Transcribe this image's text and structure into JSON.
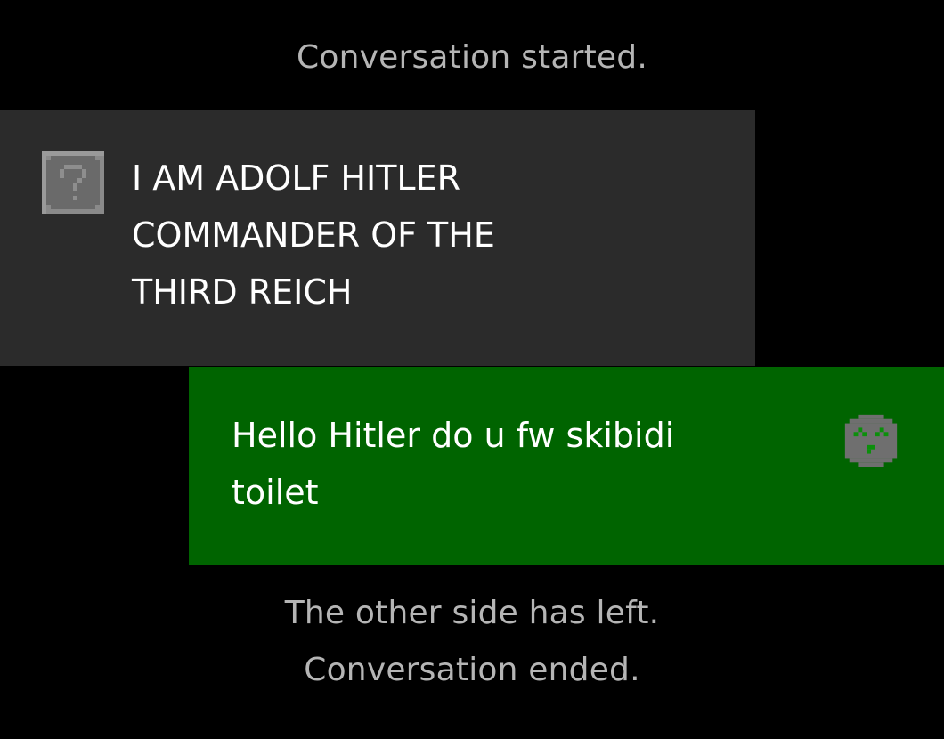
{
  "chat": {
    "start_notice": "Conversation started.",
    "messages": [
      {
        "sender": "stranger",
        "text": "I AM ADOLF HITLER\nCOMMANDER OF THE\nTHIRD REICH",
        "avatar_icon": "question-block-icon",
        "bubble_color": "#2b2b2b"
      },
      {
        "sender": "you",
        "text": "Hello Hitler do u fw skibidi\ntoilet",
        "avatar_icon": "pixel-smiley-face-icon",
        "bubble_color": "#006400"
      }
    ],
    "left_notice": "The other side has left.",
    "end_notice": "Conversation ended."
  },
  "colors": {
    "background": "#000000",
    "notice_text": "#b5b5b5",
    "message_text": "#ffffff"
  }
}
